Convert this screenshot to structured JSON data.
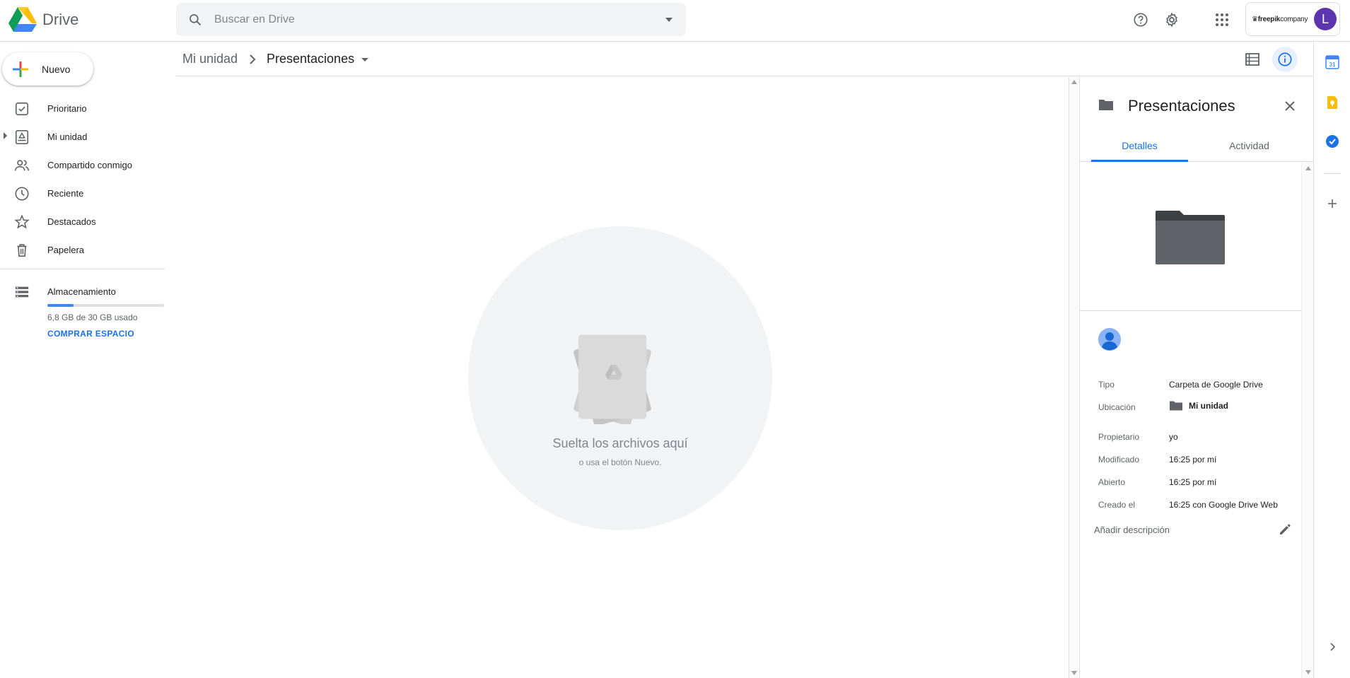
{
  "app": {
    "name": "Drive"
  },
  "search": {
    "placeholder": "Buscar en Drive"
  },
  "account": {
    "brand_bold": "freepik",
    "brand_rest": "company",
    "avatar_letter": "L"
  },
  "sidebar": {
    "new_label": "Nuevo",
    "items": [
      {
        "label": "Prioritario",
        "icon": "priority-icon"
      },
      {
        "label": "Mi unidad",
        "icon": "my-drive-icon"
      },
      {
        "label": "Compartido conmigo",
        "icon": "shared-icon"
      },
      {
        "label": "Reciente",
        "icon": "recent-clock-icon"
      },
      {
        "label": "Destacados",
        "icon": "star-icon"
      },
      {
        "label": "Papelera",
        "icon": "trash-icon"
      }
    ],
    "storage": {
      "label": "Almacenamiento",
      "usage": "6,8 GB de 30 GB usado",
      "used_fraction": 0.227,
      "buy_label": "COMPRAR ESPACIO"
    }
  },
  "breadcrumb": {
    "root": "Mi unidad",
    "current": "Presentaciones"
  },
  "main": {
    "drop_title": "Suelta los archivos aquí",
    "drop_subtitle": "o usa el botón Nuevo."
  },
  "details": {
    "title": "Presentaciones",
    "tabs": [
      "Detalles",
      "Actividad"
    ],
    "props": {
      "type_label": "Tipo",
      "type_value": "Carpeta de Google Drive",
      "location_label": "Ubicación",
      "location_value": "Mi unidad",
      "owner_label": "Propietario",
      "owner_value": "yo",
      "modified_label": "Modificado",
      "modified_value": "16:25 por mí",
      "opened_label": "Abierto",
      "opened_value": "16:25 por mí",
      "created_label": "Creado el",
      "created_value": "16:25 con Google Drive Web"
    },
    "add_description": "Añadir descripción"
  },
  "rail": {
    "calendar_day": "31"
  },
  "colors": {
    "accent": "#1a73e8",
    "folder": "#5f6368"
  }
}
